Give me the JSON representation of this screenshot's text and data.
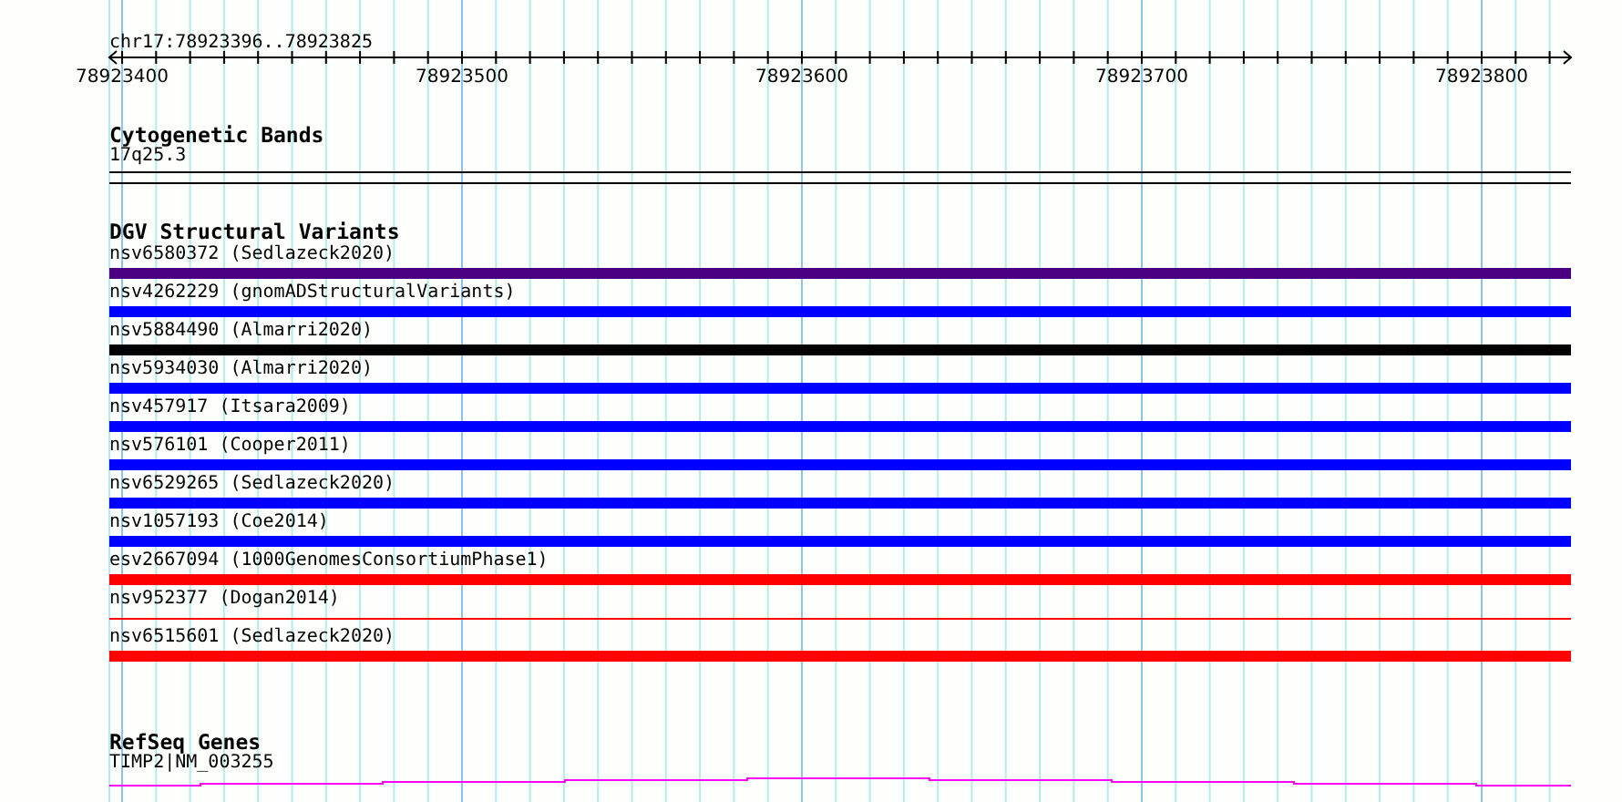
{
  "location": "chr17:78923396..78923825",
  "ruler": {
    "labels": [
      "78923400",
      "78923500",
      "78923600",
      "78923700",
      "78923800"
    ]
  },
  "tracks": [
    {
      "title": "Cytogenetic Bands",
      "kind": "bands",
      "features": [
        {
          "label": "17q25.3"
        }
      ]
    },
    {
      "title": "DGV Structural Variants",
      "kind": "variants",
      "features": [
        {
          "label": "nsv6580372 (Sedlazeck2020)",
          "color": "#4b0082",
          "kind": "thick"
        },
        {
          "label": "nsv4262229 (gnomADStructuralVariants)",
          "color": "#0000ff",
          "kind": "thick"
        },
        {
          "label": "nsv5884490 (Almarri2020)",
          "color": "#000000",
          "kind": "thick"
        },
        {
          "label": "nsv5934030 (Almarri2020)",
          "color": "#0000ff",
          "kind": "thick"
        },
        {
          "label": "nsv457917 (Itsara2009)",
          "color": "#0000ff",
          "kind": "thick"
        },
        {
          "label": "nsv576101 (Cooper2011)",
          "color": "#0000ff",
          "kind": "thick"
        },
        {
          "label": "nsv6529265 (Sedlazeck2020)",
          "color": "#0000ff",
          "kind": "thick"
        },
        {
          "label": "nsv1057193 (Coe2014)",
          "color": "#0000ff",
          "kind": "thick"
        },
        {
          "label": "esv2667094 (1000GenomesConsortiumPhase1)",
          "color": "#ff0000",
          "kind": "thick"
        },
        {
          "label": "nsv952377 (Dogan2014)",
          "color": "#ff0000",
          "kind": "thin"
        },
        {
          "label": "nsv6515601 (Sedlazeck2020)",
          "color": "#ff0000",
          "kind": "thick"
        }
      ]
    },
    {
      "title": "RefSeq Genes",
      "kind": "genes",
      "features": [
        {
          "label": "TIMP2|NM_003255"
        }
      ]
    }
  ]
}
